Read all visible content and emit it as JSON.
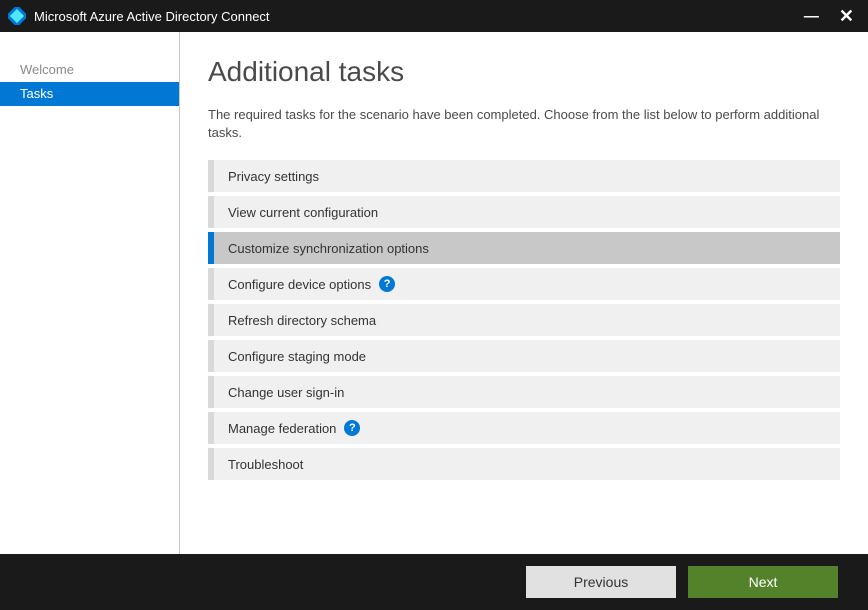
{
  "titlebar": {
    "title": "Microsoft Azure Active Directory Connect"
  },
  "sidebar": {
    "items": [
      {
        "label": "Welcome",
        "state": "visited"
      },
      {
        "label": "Tasks",
        "state": "active"
      }
    ]
  },
  "main": {
    "heading": "Additional tasks",
    "description": "The required tasks for the scenario have been completed. Choose from the list below to perform additional tasks.",
    "tasks": [
      {
        "label": "Privacy settings",
        "selected": false,
        "help": false
      },
      {
        "label": "View current configuration",
        "selected": false,
        "help": false
      },
      {
        "label": "Customize synchronization options",
        "selected": true,
        "help": false
      },
      {
        "label": "Configure device options",
        "selected": false,
        "help": true
      },
      {
        "label": "Refresh directory schema",
        "selected": false,
        "help": false
      },
      {
        "label": "Configure staging mode",
        "selected": false,
        "help": false
      },
      {
        "label": "Change user sign-in",
        "selected": false,
        "help": false
      },
      {
        "label": "Manage federation",
        "selected": false,
        "help": true
      },
      {
        "label": "Troubleshoot",
        "selected": false,
        "help": false
      }
    ]
  },
  "footer": {
    "previous": "Previous",
    "next": "Next"
  }
}
